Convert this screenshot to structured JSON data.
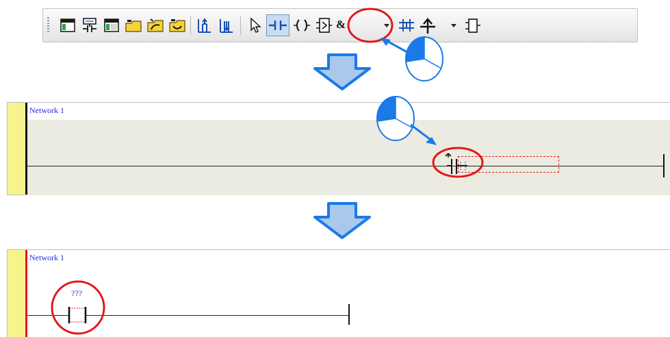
{
  "toolbar": {
    "combo_value": "&",
    "tools": [
      "window-icon",
      "network-icon",
      "window-alt-icon",
      "folder-icon",
      "folder-open-icon",
      "folder-link-icon",
      "insert-above-icon",
      "insert-below-icon",
      "select-pointer-icon",
      "contact-icon",
      "coil-icon",
      "function-block-icon",
      "parallel-branch-icon",
      "rising-edge-icon",
      "box-icon"
    ]
  },
  "pane1": {
    "network_label": "Network 1"
  },
  "pane2": {
    "network_label": "Network 1",
    "contact_operand": "???"
  },
  "colors": {
    "rail_yellow": "#f7f48e",
    "highlight_red": "#e11818",
    "arrow_blue": "#1a7ae8",
    "net_label_blue": "#2a2ae0"
  }
}
